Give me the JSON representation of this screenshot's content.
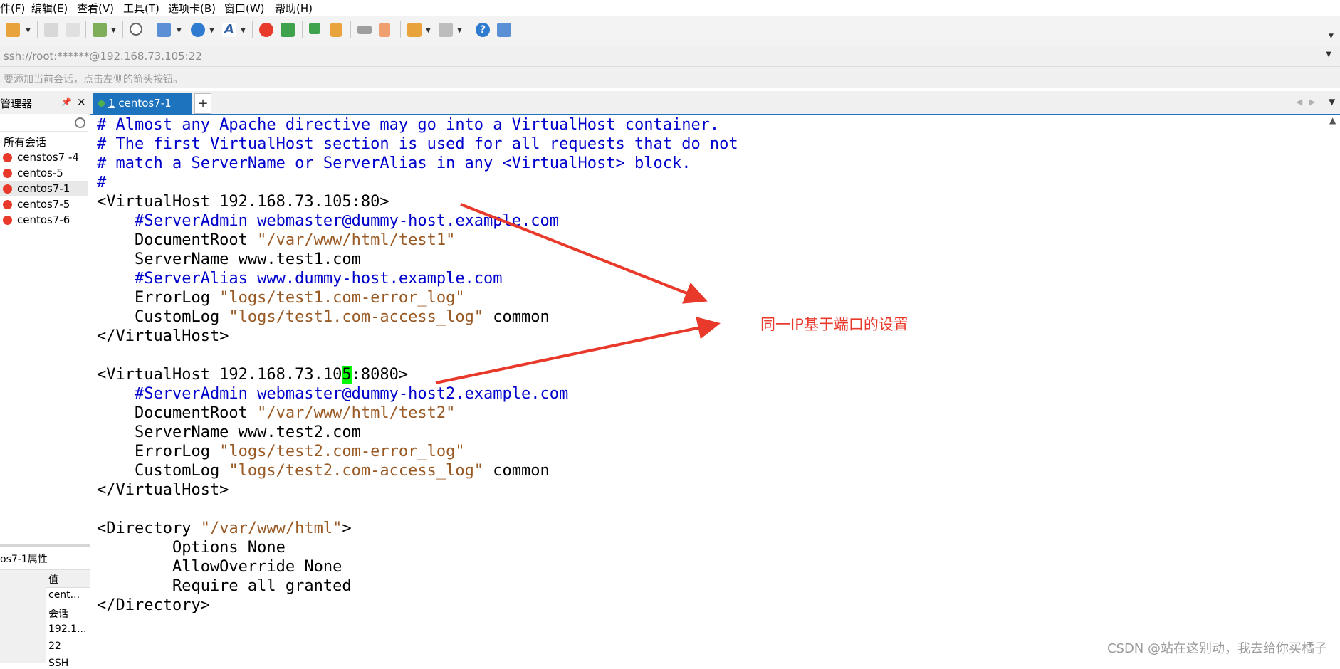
{
  "menu": [
    "件(F)",
    "编辑(E)",
    "查看(V)",
    "工具(T)",
    "选项卡(B)",
    "窗口(W)",
    "帮助(H)"
  ],
  "address_bar": {
    "text": "ssh://root:******@192.168.73.105:22"
  },
  "hint_bar": {
    "text": "要添加当前会话，点击左侧的箭头按钮。"
  },
  "session_manager": {
    "title": "管理器",
    "group": "所有会话",
    "sessions": [
      "censtos7 -4",
      "centos-5",
      "centos7-1",
      "centos7-5",
      "centos7-6"
    ],
    "selected_index": 2
  },
  "tab": {
    "number": "1",
    "label": "centos7-1"
  },
  "new_tab_label": "+",
  "properties": {
    "title": "os7-1属性",
    "value_header": "值",
    "values": [
      "cent...",
      "会话",
      "192.1...",
      "22",
      "SSH"
    ]
  },
  "terminal": {
    "lines": [
      [
        {
          "t": "# Almost any Apache directive may go into a VirtualHost container.",
          "c": "cm"
        }
      ],
      [
        {
          "t": "# The first VirtualHost section is used for all requests that do not",
          "c": "cm"
        }
      ],
      [
        {
          "t": "# match a ServerName or ServerAlias in any <VirtualHost> block.",
          "c": "cm"
        }
      ],
      [
        {
          "t": "#",
          "c": "cm"
        }
      ],
      [
        {
          "t": "<VirtualHost 192.168.73.105:80>",
          "c": "tx"
        }
      ],
      [
        {
          "t": "    #ServerAdmin webmaster@dummy-host.example.com",
          "c": "cm"
        }
      ],
      [
        {
          "t": "    DocumentRoot ",
          "c": "tx"
        },
        {
          "t": "\"/var/www/html/test1\"",
          "c": "st"
        }
      ],
      [
        {
          "t": "    ServerName www.test1.com",
          "c": "tx"
        }
      ],
      [
        {
          "t": "    #ServerAlias www.dummy-host.example.com",
          "c": "cm"
        }
      ],
      [
        {
          "t": "    ErrorLog ",
          "c": "tx"
        },
        {
          "t": "\"logs/test1.com-error_log\"",
          "c": "st"
        }
      ],
      [
        {
          "t": "    CustomLog ",
          "c": "tx"
        },
        {
          "t": "\"logs/test1.com-access_log\"",
          "c": "st"
        },
        {
          "t": " common",
          "c": "tx"
        }
      ],
      [
        {
          "t": "</VirtualHost>",
          "c": "tx"
        }
      ],
      [
        {
          "t": "",
          "c": "tx"
        }
      ],
      [
        {
          "t": "<VirtualHost 192.168.73.10",
          "c": "tx"
        },
        {
          "t": "5",
          "c": "tx hl"
        },
        {
          "t": ":8080>",
          "c": "tx"
        }
      ],
      [
        {
          "t": "    #ServerAdmin webmaster@dummy-host2.example.com",
          "c": "cm"
        }
      ],
      [
        {
          "t": "    DocumentRoot ",
          "c": "tx"
        },
        {
          "t": "\"/var/www/html/test2\"",
          "c": "st"
        }
      ],
      [
        {
          "t": "    ServerName www.test2.com",
          "c": "tx"
        }
      ],
      [
        {
          "t": "    ErrorLog ",
          "c": "tx"
        },
        {
          "t": "\"logs/test2.com-error_log\"",
          "c": "st"
        }
      ],
      [
        {
          "t": "    CustomLog ",
          "c": "tx"
        },
        {
          "t": "\"logs/test2.com-access_log\"",
          "c": "st"
        },
        {
          "t": " common",
          "c": "tx"
        }
      ],
      [
        {
          "t": "</VirtualHost>",
          "c": "tx"
        }
      ],
      [
        {
          "t": "",
          "c": "tx"
        }
      ],
      [
        {
          "t": "<Directory ",
          "c": "tx"
        },
        {
          "t": "\"/var/www/html\"",
          "c": "st"
        },
        {
          "t": ">",
          "c": "tx"
        }
      ],
      [
        {
          "t": "        Options None",
          "c": "tx"
        }
      ],
      [
        {
          "t": "        AllowOverride None",
          "c": "tx"
        }
      ],
      [
        {
          "t": "        Require all granted",
          "c": "tx"
        }
      ],
      [
        {
          "t": "</Directory>",
          "c": "tx"
        }
      ]
    ]
  },
  "annotation": {
    "text": "同一IP基于端口的设置",
    "color": "#e8392b"
  },
  "watermark": "CSDN @站在这别动，我去给你买橘子"
}
